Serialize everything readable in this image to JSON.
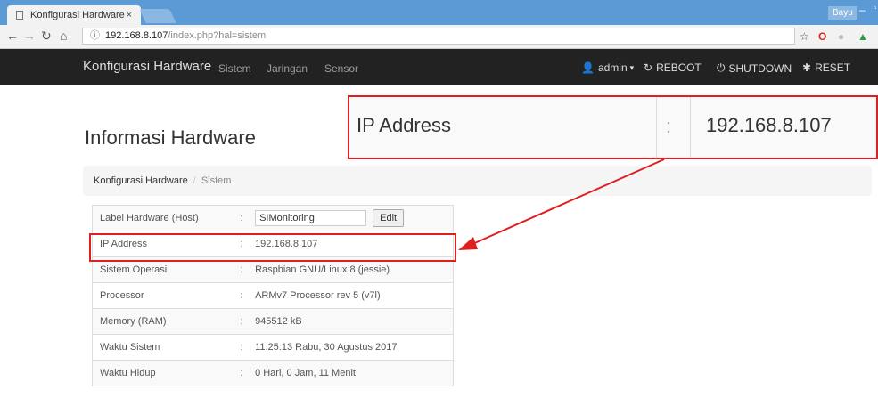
{
  "browser": {
    "tab_title": "Konfigurasi Hardware",
    "tab_close": "×",
    "user": "Bayu",
    "url_host": "192.168.8.107",
    "url_path": "/index.php?hal=sistem"
  },
  "navbar": {
    "brand": "Konfigurasi Hardware",
    "items": [
      "Sistem",
      "Jaringan",
      "Sensor"
    ],
    "user_menu": "admin",
    "reboot": "REBOOT",
    "shutdown": "SHUTDOWN",
    "reset": "RESET"
  },
  "page": {
    "title": "Informasi Hardware",
    "breadcrumb": [
      "Konfigurasi Hardware",
      "Sistem"
    ],
    "breadcrumb_sep": "/",
    "colon": ":",
    "rows": [
      {
        "label": "Label Hardware (Host)",
        "value": "SIMonitoring"
      },
      {
        "label": "IP Address",
        "value": "192.168.8.107"
      },
      {
        "label": "Sistem Operasi",
        "value": "Raspbian GNU/Linux 8 (jessie)"
      },
      {
        "label": "Processor",
        "value": "ARMv7 Processor rev 5 (v7l)"
      },
      {
        "label": "Memory (RAM)",
        "value": "945512 kB"
      },
      {
        "label": "Waktu Sistem",
        "value": "11:25:13 Rabu, 30 Agustus 2017"
      },
      {
        "label": "Waktu Hidup",
        "value": "0 Hari, 0 Jam, 11 Menit"
      }
    ],
    "edit_label": "Edit"
  },
  "zoom": {
    "label": "IP Address",
    "colon": ":",
    "value": "192.168.8.107"
  },
  "colors": {
    "highlight": "#e02020",
    "navbar": "#222222",
    "tabstrip": "#5b9ad5"
  }
}
